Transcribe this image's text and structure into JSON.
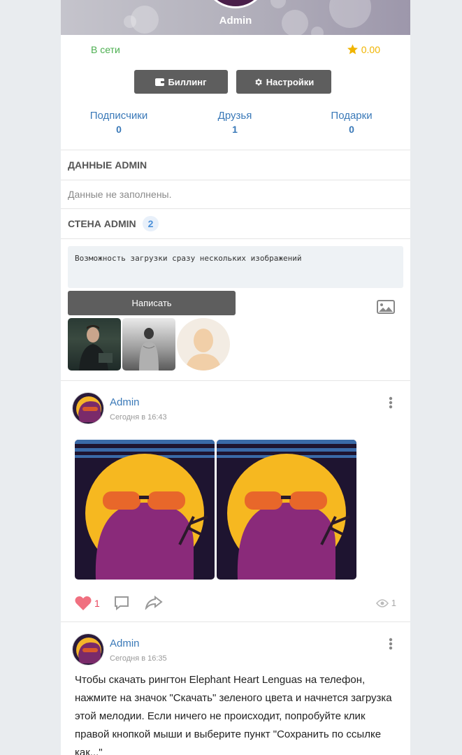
{
  "profile": {
    "name": "Admin",
    "status": "В сети",
    "balance": "0.00"
  },
  "buttons": {
    "billing": "Биллинг",
    "settings": "Настройки"
  },
  "counters": [
    {
      "label": "Подписчики",
      "value": "0"
    },
    {
      "label": "Друзья",
      "value": "1"
    },
    {
      "label": "Подарки",
      "value": "0"
    }
  ],
  "data_section": {
    "title": "ДАННЫЕ ADMIN",
    "empty_text": "Данные не заполнены."
  },
  "wall": {
    "title": "СТЕНА ADMIN",
    "count": "2",
    "composer_value": "Возможность загрузки сразу нескольких изображений",
    "write_label": "Написать"
  },
  "posts": [
    {
      "author": "Admin",
      "time": "Сегодня в 16:43",
      "likes": "1",
      "views": "1"
    },
    {
      "author": "Admin",
      "time": "Сегодня в 16:35",
      "text": "Чтобы скачать рингтон Elephant Heart Lenguas на телефон, нажмите на значок \"Скачать\" зеленого цвета и начнется загрузка этой мелодии. Если ничего не происходит, попробуйте клик правой кнопкой мыши и выберите пункт \"Сохранить по ссылке как...\""
    }
  ],
  "colors": {
    "link": "#3a79b8",
    "online": "#4caf50",
    "balance": "#f0b400",
    "button": "#5e5e5e",
    "like": "#e8475e"
  },
  "icons": [
    "star-icon",
    "wallet-icon",
    "gear-icon",
    "image-upload-icon",
    "more-vertical-icon",
    "heart-icon",
    "comment-icon",
    "share-icon",
    "eye-icon"
  ]
}
